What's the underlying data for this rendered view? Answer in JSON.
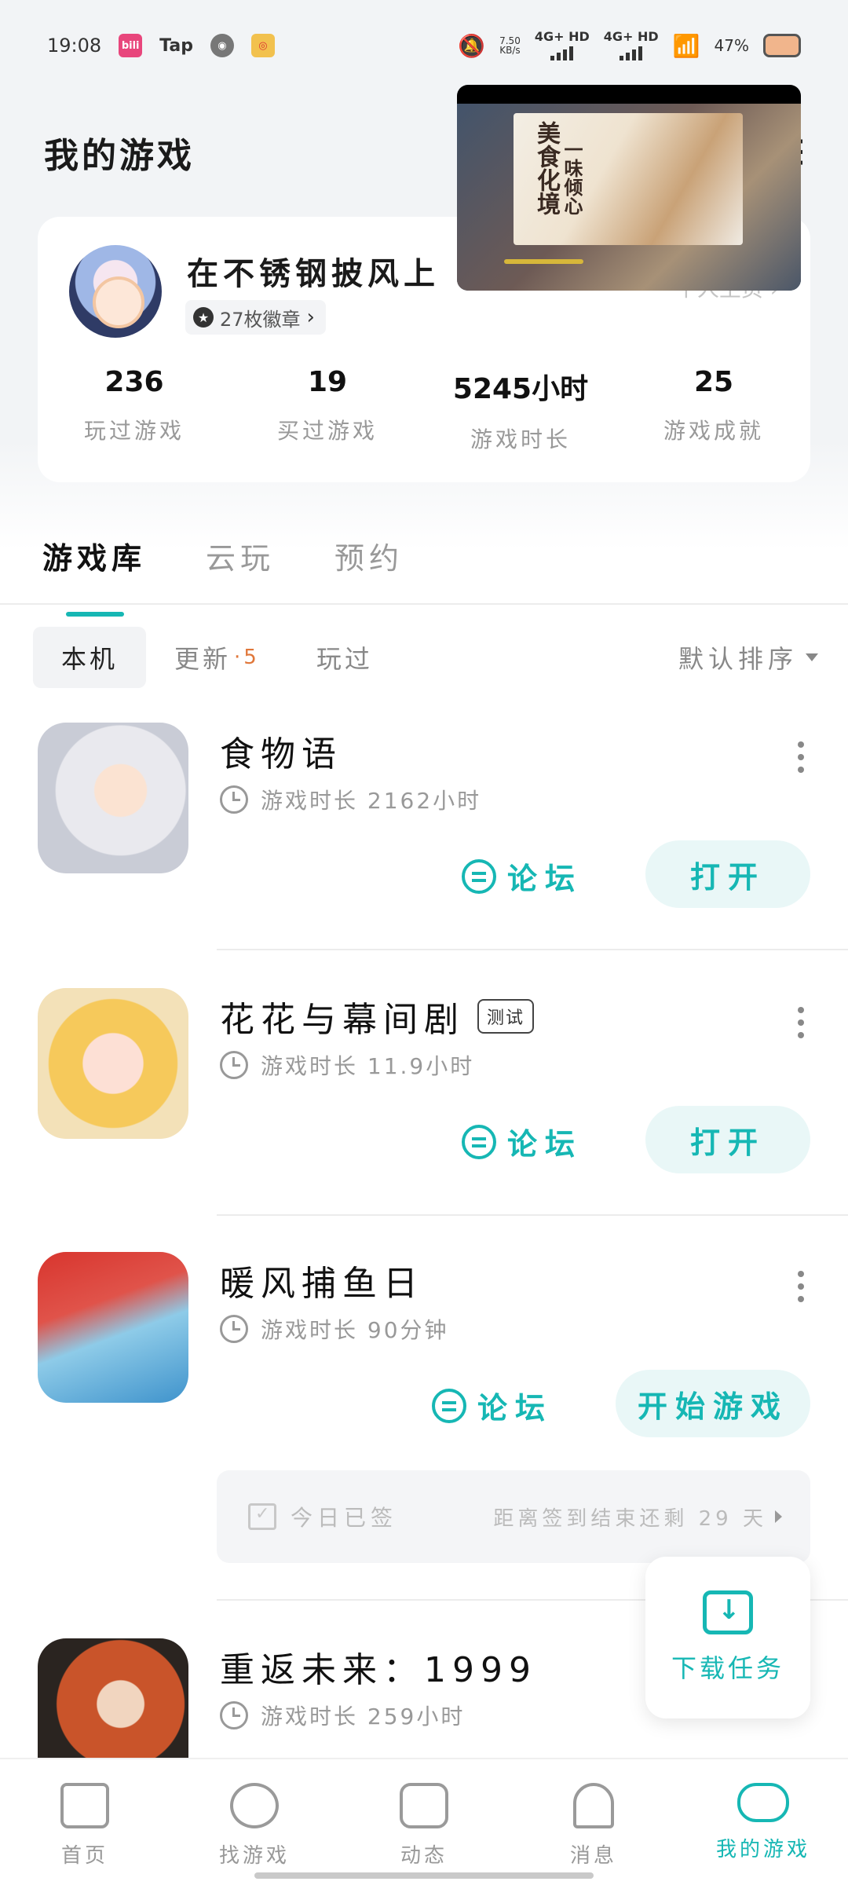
{
  "status_bar": {
    "time": "19:08",
    "apps": [
      "bilibili",
      "Tap",
      "weibo"
    ],
    "net_speed_value": "7.50",
    "net_speed_unit": "KB/s",
    "sim1": "4G+ HD",
    "sim2": "4G+ HD",
    "battery": "47%"
  },
  "header": {
    "title": "我的游戏"
  },
  "profile": {
    "username": "在不锈钢披风上",
    "badge_count_label": "27枚徽章",
    "homepage_link": "个人主页",
    "stats": [
      {
        "value": "236",
        "label": "玩过游戏"
      },
      {
        "value": "19",
        "label": "买过游戏"
      },
      {
        "value": "5245小时",
        "label": "游戏时长"
      },
      {
        "value": "25",
        "label": "游戏成就"
      }
    ]
  },
  "video_overlay": {
    "title_line1": "美食化境",
    "title_line2": "一味倾心",
    "progress_fraction": 0.18
  },
  "tabs": [
    {
      "label": "游戏库",
      "active": true
    },
    {
      "label": "云玩",
      "active": false
    },
    {
      "label": "预约",
      "active": false
    }
  ],
  "filters": {
    "chips": [
      {
        "label": "本机",
        "active": true
      },
      {
        "label": "更新",
        "count": "5",
        "active": false
      },
      {
        "label": "玩过",
        "active": false
      }
    ],
    "sort_label": "默认排序"
  },
  "games": [
    {
      "name": "食物语",
      "tag": "",
      "time_label": "游戏时长 2162小时",
      "forum_label": "论坛",
      "action_label": "打开"
    },
    {
      "name": "花花与幕间剧",
      "tag": "测试",
      "time_label": "游戏时长 11.9小时",
      "forum_label": "论坛",
      "action_label": "打开"
    },
    {
      "name": "暖风捕鱼日",
      "tag": "",
      "time_label": "游戏时长 90分钟",
      "forum_label": "论坛",
      "action_label": "开始游戏"
    },
    {
      "name": "重返未来：1999",
      "tag": "",
      "time_label": "游戏时长 259小时"
    }
  ],
  "signin": {
    "status": "今日已签",
    "remaining": "距离签到结束还剩 29 天"
  },
  "download_task": {
    "label": "下载任务"
  },
  "bottom_nav": [
    {
      "label": "首页",
      "icon": "home-icon",
      "active": false
    },
    {
      "label": "找游戏",
      "icon": "planet-icon",
      "active": false
    },
    {
      "label": "动态",
      "icon": "chat-icon",
      "active": false
    },
    {
      "label": "消息",
      "icon": "bell-icon",
      "active": false
    },
    {
      "label": "我的游戏",
      "icon": "gamepad-icon",
      "active": true
    }
  ],
  "colors": {
    "accent": "#16b7b4",
    "update_count": "#e0773a"
  }
}
